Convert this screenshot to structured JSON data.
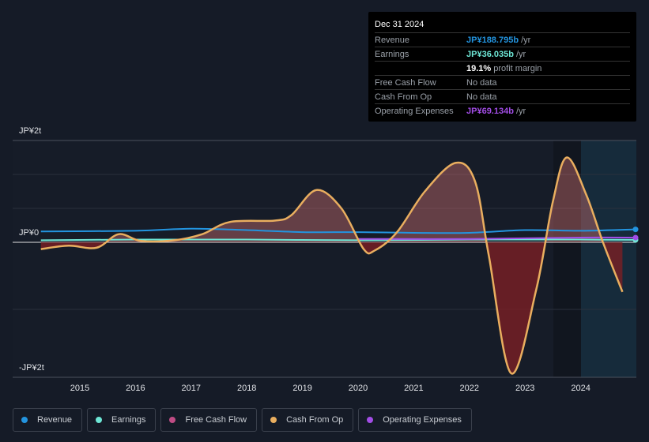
{
  "chart_data": {
    "type": "line",
    "y_labels": [
      "JP¥2t",
      "JP¥0",
      "-JP¥2t"
    ],
    "x_ticks": [
      "2015",
      "2016",
      "2017",
      "2018",
      "2019",
      "2020",
      "2021",
      "2022",
      "2023",
      "2024"
    ],
    "units": "JP¥ trillions",
    "ylim": [
      -2,
      1.5
    ],
    "series": [
      {
        "name": "Revenue",
        "color": "#2394df",
        "points": [
          [
            2014.3,
            0.16
          ],
          [
            2016,
            0.17
          ],
          [
            2017,
            0.2
          ],
          [
            2018,
            0.18
          ],
          [
            2019,
            0.15
          ],
          [
            2020,
            0.15
          ],
          [
            2021,
            0.14
          ],
          [
            2022,
            0.14
          ],
          [
            2023,
            0.18
          ],
          [
            2024,
            0.17
          ],
          [
            2025,
            0.19
          ]
        ]
      },
      {
        "name": "Earnings",
        "color": "#6ee7d6",
        "points": [
          [
            2014.3,
            0.03
          ],
          [
            2016,
            0.04
          ],
          [
            2018,
            0.04
          ],
          [
            2020,
            0.03
          ],
          [
            2022,
            0.04
          ],
          [
            2024,
            0.04
          ],
          [
            2025,
            0.036
          ]
        ]
      },
      {
        "name": "Free Cash Flow",
        "color": "#c04c85",
        "points": []
      },
      {
        "name": "Cash From Op",
        "color": "#e9ae5f",
        "points": [
          [
            2014.3,
            -0.1
          ],
          [
            2014.8,
            -0.05
          ],
          [
            2015.3,
            -0.08
          ],
          [
            2015.7,
            0.12
          ],
          [
            2016.1,
            0.02
          ],
          [
            2016.7,
            0.03
          ],
          [
            2017.2,
            0.12
          ],
          [
            2017.7,
            0.3
          ],
          [
            2018.5,
            0.32
          ],
          [
            2018.8,
            0.4
          ],
          [
            2019.25,
            0.77
          ],
          [
            2019.7,
            0.5
          ],
          [
            2020.1,
            -0.1
          ],
          [
            2020.3,
            -0.12
          ],
          [
            2020.7,
            0.15
          ],
          [
            2021.2,
            0.75
          ],
          [
            2021.75,
            1.17
          ],
          [
            2022.1,
            0.9
          ],
          [
            2022.35,
            -0.2
          ],
          [
            2022.75,
            -1.93
          ],
          [
            2023.2,
            -0.7
          ],
          [
            2023.5,
            0.6
          ],
          [
            2023.75,
            1.25
          ],
          [
            2024.1,
            0.7
          ],
          [
            2024.4,
            0
          ],
          [
            2024.75,
            -0.73
          ]
        ]
      },
      {
        "name": "Operating Expenses",
        "color": "#a24de6",
        "points": [
          [
            2020,
            0.05
          ],
          [
            2022,
            0.05
          ],
          [
            2024,
            0.07
          ],
          [
            2025,
            0.069
          ]
        ]
      }
    ]
  },
  "tooltip": {
    "date": "Dec 31 2024",
    "rows": [
      {
        "label": "Revenue",
        "value": "JP¥188.795b",
        "unit": "/yr",
        "color": "#2394df"
      },
      {
        "label": "Earnings",
        "value": "JP¥36.035b",
        "unit": "/yr",
        "color": "#6ee7d6"
      },
      {
        "label": "",
        "value": "19.1%",
        "unit": "profit margin",
        "color": "#ffffff"
      },
      {
        "label": "Free Cash Flow",
        "value": "",
        "unit": "No data",
        "color": "#9aa0a8"
      },
      {
        "label": "Cash From Op",
        "value": "",
        "unit": "No data",
        "color": "#9aa0a8"
      },
      {
        "label": "Operating Expenses",
        "value": "JP¥69.134b",
        "unit": "/yr",
        "color": "#a24de6"
      }
    ]
  }
}
